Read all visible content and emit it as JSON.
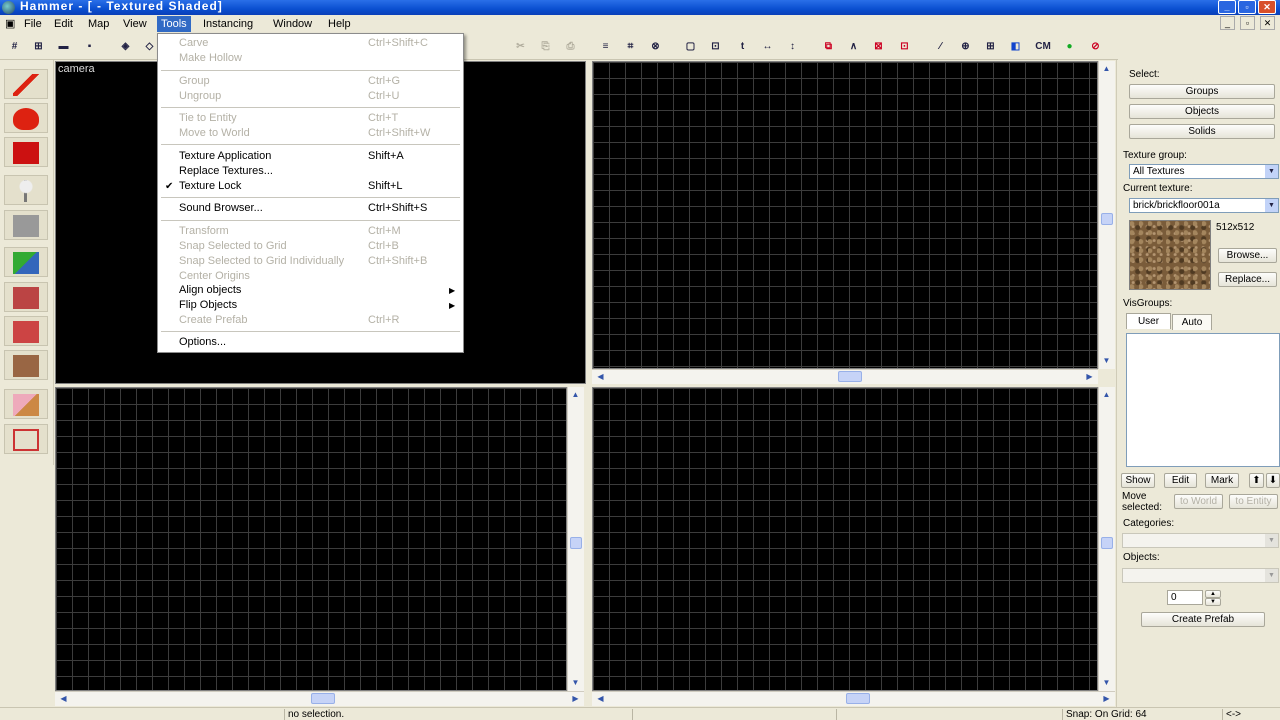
{
  "window": {
    "title": "Hammer - [ - Textured Shaded]",
    "buttons": [
      "_",
      "▫",
      "✕"
    ]
  },
  "menubar": {
    "items": [
      "File",
      "Edit",
      "Map",
      "View",
      "Tools",
      "Instancing",
      "Window",
      "Help"
    ]
  },
  "toolbar": {
    "buttons": [
      "#",
      "⊞",
      "▬",
      "▪",
      "◈",
      "◇",
      "✂",
      "⎘",
      "⎙",
      "≡",
      "⌗",
      "⊗",
      "▢",
      "⊡",
      "t",
      "↔",
      "↕",
      "⧉",
      "∧",
      "⊠",
      "⊡",
      "∕",
      "⊕",
      "⊞",
      "◧",
      "CM",
      "●",
      "⊘"
    ]
  },
  "palette": {
    "tools": [
      "selection-tool",
      "magnify-tool",
      "camera-tool",
      "entity-tool",
      "block-tool",
      "texture-tool",
      "apply-texture-tool",
      "decal-tool",
      "overlay-tool",
      "clipping-tool",
      "vertex-tool"
    ]
  },
  "viewports": {
    "camera_label": "camera"
  },
  "tools_menu": {
    "items": [
      {
        "label": "Carve",
        "shortcut": "Ctrl+Shift+C",
        "disabled": true
      },
      {
        "label": "Make Hollow",
        "shortcut": "",
        "disabled": true
      },
      {
        "label": "Group",
        "shortcut": "Ctrl+G",
        "disabled": true
      },
      {
        "label": "Ungroup",
        "shortcut": "Ctrl+U",
        "disabled": true
      },
      {
        "label": "Tie to Entity",
        "shortcut": "Ctrl+T",
        "disabled": true
      },
      {
        "label": "Move to World",
        "shortcut": "Ctrl+Shift+W",
        "disabled": true
      },
      {
        "label": "Texture Application",
        "shortcut": "Shift+A",
        "disabled": false
      },
      {
        "label": "Replace Textures...",
        "shortcut": "",
        "disabled": false
      },
      {
        "label": "Texture Lock",
        "shortcut": "Shift+L",
        "disabled": false,
        "checked": true
      },
      {
        "label": "Sound Browser...",
        "shortcut": "Ctrl+Shift+S",
        "disabled": false
      },
      {
        "label": "Transform",
        "shortcut": "Ctrl+M",
        "disabled": true
      },
      {
        "label": "Snap Selected to Grid",
        "shortcut": "Ctrl+B",
        "disabled": true
      },
      {
        "label": "Snap Selected to Grid Individually",
        "shortcut": "Ctrl+Shift+B",
        "disabled": true
      },
      {
        "label": "Center Origins",
        "shortcut": "",
        "disabled": true
      },
      {
        "label": "Align objects",
        "shortcut": "",
        "disabled": false,
        "submenu": true
      },
      {
        "label": "Flip Objects",
        "shortcut": "",
        "disabled": false,
        "submenu": true
      },
      {
        "label": "Create Prefab",
        "shortcut": "Ctrl+R",
        "disabled": true
      },
      {
        "label": "Options...",
        "shortcut": "",
        "disabled": false
      }
    ]
  },
  "right_panel": {
    "select_label": "Select:",
    "groups_button": "Groups",
    "objects_button": "Objects",
    "solids_button": "Solids",
    "texture_group_label": "Texture group:",
    "texture_group_value": "All Textures",
    "current_texture_label": "Current texture:",
    "current_texture_value": "brick/brickfloor001a",
    "texture_size": "512x512",
    "browse_button": "Browse...",
    "replace_button": "Replace...",
    "visgroups_label": "VisGroups:",
    "tab_user": "User",
    "tab_auto": "Auto",
    "show_button": "Show",
    "edit_button": "Edit",
    "mark_button": "Mark",
    "up_button": "⬆",
    "down_button": "⬇",
    "move_selected_label_1": "Move",
    "move_selected_label_2": "selected:",
    "to_world_button": "to World",
    "to_entity_button": "to Entity",
    "categories_label": "Categories:",
    "objects_label": "Objects:",
    "spinner_value": "0",
    "create_prefab_button": "Create Prefab"
  },
  "statusbar": {
    "selection": "no selection.",
    "snap": "Snap: On Grid: 64",
    "extra": "<->"
  },
  "colors": {
    "titlebar": "#0a4fd0",
    "menu_highlight": "#316ac5",
    "viewport_bg": "#000000",
    "grid_line": "#3c3c3c"
  }
}
